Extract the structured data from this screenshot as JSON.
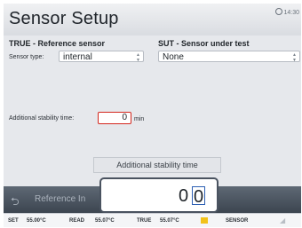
{
  "header": {
    "title": "Sensor Setup",
    "clock": "14:30"
  },
  "reference": {
    "title": "TRUE - Reference sensor",
    "sensor_type_label": "Sensor type:",
    "sensor_type_value": "internal",
    "stability_label": "Additional stability time:",
    "stability_value": "0",
    "stability_unit": "min"
  },
  "sut": {
    "title": "SUT - Sensor under test",
    "sensor_type_value": "None"
  },
  "bottom_bar": {
    "label": "Reference In"
  },
  "numpad": {
    "title": "Additional stability time",
    "digit_1": "0",
    "digit_2": "0"
  },
  "status": {
    "set_label": "SET",
    "set_value": "55.00°C",
    "read_label": "READ",
    "read_value": "55.07°C",
    "true_label": "TRUE",
    "true_value": "55.07°C",
    "sensor_label": "SENSOR",
    "true_swatch_color": "#f2c21a"
  },
  "icons": {
    "updown": "↕",
    "back": "back-arrow-icon",
    "signal": "signal-icon"
  }
}
